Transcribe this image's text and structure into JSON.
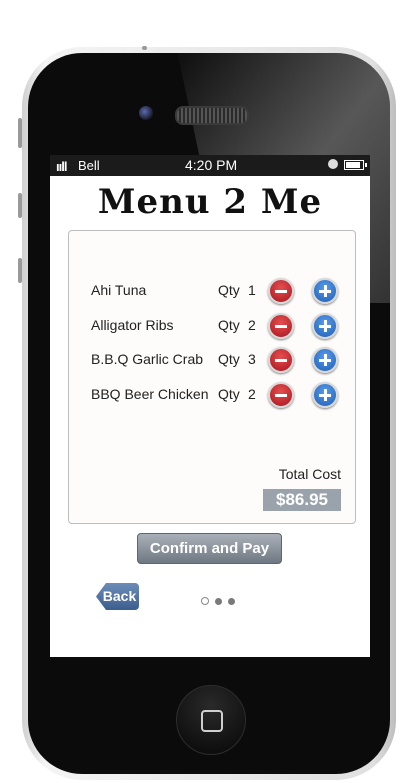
{
  "status_bar": {
    "signal": "ııll",
    "carrier": "Bell",
    "time": "4:20 PM",
    "battery_level": 0.9
  },
  "app": {
    "title": "Menu 2 Me"
  },
  "order": {
    "qty_label": "Qty",
    "items": [
      {
        "name": "Ahi Tuna",
        "qty": "1"
      },
      {
        "name": "Alligator Ribs",
        "qty": "2"
      },
      {
        "name": "B.B.Q Garlic Crab",
        "qty": "3"
      },
      {
        "name": "BBQ Beer Chicken",
        "qty": "2"
      }
    ],
    "total_label": "Total Cost",
    "total_value": "$86.95"
  },
  "actions": {
    "confirm_label": "Confirm and Pay",
    "back_label": "Back"
  },
  "pagination": {
    "pages": 3,
    "current": 1
  },
  "icons": {
    "remove": "minus-circle-icon",
    "add": "plus-circle-icon",
    "home": "home-button-icon"
  },
  "colors": {
    "remove": "#c4202a",
    "add": "#2e74d0",
    "total_bg": "#9aa2ab",
    "back_bg": "#4f6f9e"
  }
}
